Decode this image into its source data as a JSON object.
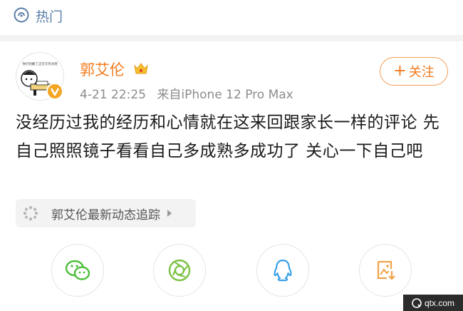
{
  "header": {
    "topic_label": "热门"
  },
  "post": {
    "author": "郭艾伦",
    "date_time": "4-21 22:25",
    "source": "来自iPhone 12 Pro Max",
    "follow_label": "关注",
    "text": "没经历过我的经历和心情就在这来回跟家长一样的评论 先自己照照镜子看看自己多成熟多成功了 关心一下自己吧",
    "avatar_caption": "你们别删了正在写作文呢"
  },
  "tracking_chip": {
    "label": "郭艾伦最新动态追踪"
  },
  "share_targets": [
    {
      "icon": "wechat-icon"
    },
    {
      "icon": "moments-icon"
    },
    {
      "icon": "qq-icon"
    },
    {
      "icon": "save-image-icon"
    }
  ],
  "watermark": {
    "text": "qtx.com"
  },
  "colors": {
    "accent": "#f37b1d",
    "link_blue": "#5a7ea8",
    "wechat_green": "#4cbf3a",
    "qq_blue": "#3aa0e8",
    "save_orange": "#f0a24a"
  }
}
